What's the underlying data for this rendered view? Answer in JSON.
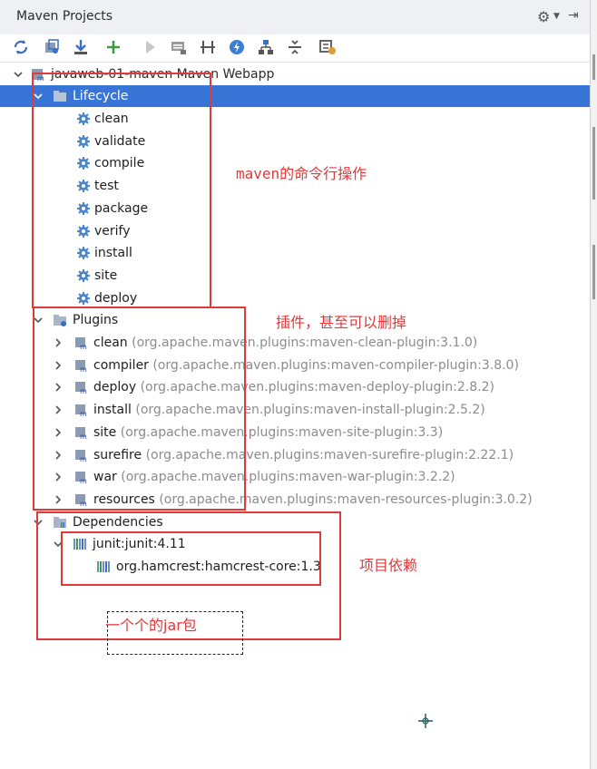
{
  "panel": {
    "title": "Maven Projects"
  },
  "header_icons": [
    "settings-gear-icon",
    "hide-panel-icon"
  ],
  "toolbar": {
    "buttons": [
      "reimport-icon",
      "generate-sources-icon",
      "download-icon",
      "add-icon",
      "run-icon",
      "run-configuration-icon",
      "toggle-offline-icon",
      "skip-tests-icon",
      "show-dependencies-icon",
      "collapse-all-icon",
      "settings-icon"
    ]
  },
  "tree": {
    "project": "javaweb-01-maven Maven Webapp",
    "lifecycle": {
      "label": "Lifecycle",
      "items": [
        "clean",
        "validate",
        "compile",
        "test",
        "package",
        "verify",
        "install",
        "site",
        "deploy"
      ]
    },
    "plugins": {
      "label": "Plugins",
      "items": [
        {
          "name": "clean",
          "detail": "(org.apache.maven.plugins:maven-clean-plugin:3.1.0)"
        },
        {
          "name": "compiler",
          "detail": "(org.apache.maven.plugins:maven-compiler-plugin:3.8.0)"
        },
        {
          "name": "deploy",
          "detail": "(org.apache.maven.plugins:maven-deploy-plugin:2.8.2)"
        },
        {
          "name": "install",
          "detail": "(org.apache.maven.plugins:maven-install-plugin:2.5.2)"
        },
        {
          "name": "site",
          "detail": "(org.apache.maven.plugins:maven-site-plugin:3.3)"
        },
        {
          "name": "surefire",
          "detail": "(org.apache.maven.plugins:maven-surefire-plugin:2.22.1)"
        },
        {
          "name": "war",
          "detail": "(org.apache.maven.plugins:maven-war-plugin:3.2.2)"
        },
        {
          "name": "resources",
          "detail": "(org.apache.maven.plugins:maven-resources-plugin:3.0.2)"
        }
      ]
    },
    "dependencies": {
      "label": "Dependencies",
      "items": [
        "junit:junit:4.11"
      ],
      "sub_items": [
        "org.hamcrest:hamcrest-core:1.3"
      ]
    }
  },
  "annotations": {
    "lifecycle_note": "maven的命令行操作",
    "plugins_note": "插件，甚至可以删掉",
    "dependencies_note": "项目依赖",
    "jar_note": "一个个的jar包"
  },
  "colors": {
    "selection": "#3875d7",
    "annotation": "#e0393a",
    "muted_text": "#8c8c8c"
  }
}
